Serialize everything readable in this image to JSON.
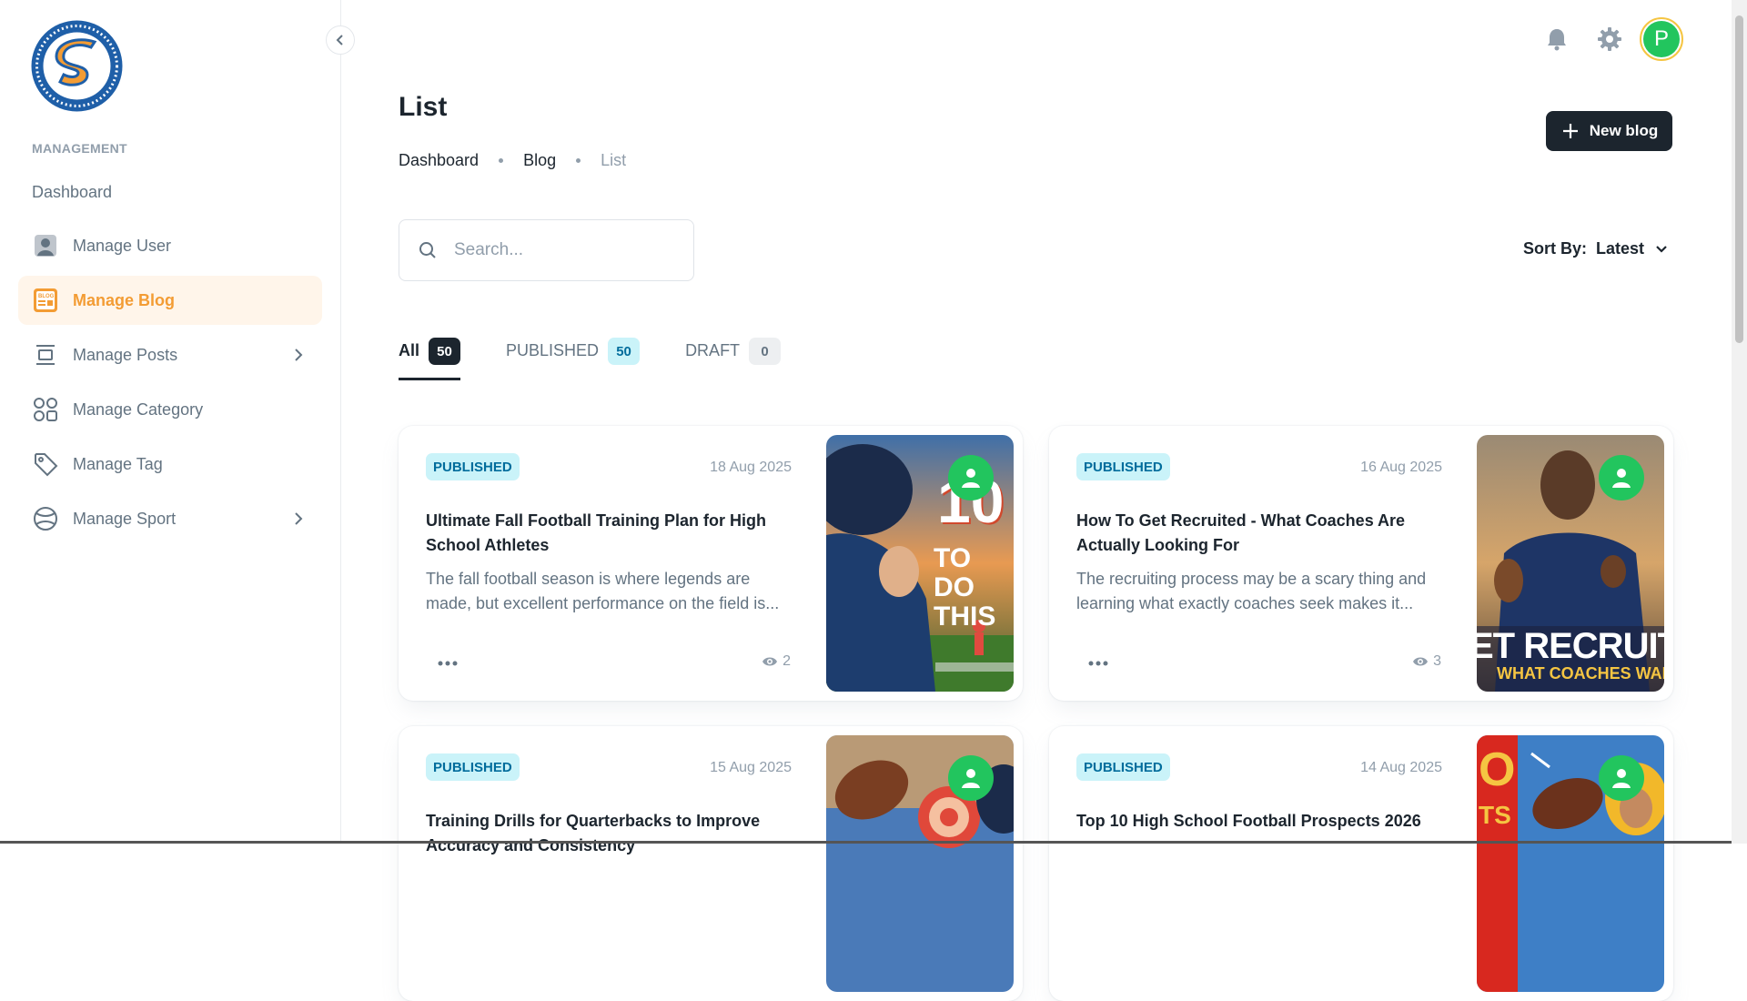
{
  "sidebar": {
    "subheader": "MANAGEMENT",
    "dashboard": "Dashboard",
    "items": [
      {
        "label": "Manage User"
      },
      {
        "label": "Manage Blog"
      },
      {
        "label": "Manage Posts"
      },
      {
        "label": "Manage Category"
      },
      {
        "label": "Manage Tag"
      },
      {
        "label": "Manage Sport"
      }
    ],
    "active_color": "#f39c34"
  },
  "header": {
    "avatar_letter": "P"
  },
  "page": {
    "title": "List",
    "breadcrumb": [
      "Dashboard",
      "Blog",
      "List"
    ],
    "new_button": "New blog",
    "search_placeholder": "Search...",
    "sort_label": "Sort By:",
    "sort_value": "Latest"
  },
  "tabs": [
    {
      "label": "All",
      "count": "50"
    },
    {
      "label": "PUBLISHED",
      "count": "50"
    },
    {
      "label": "DRAFT",
      "count": "0"
    }
  ],
  "posts": [
    {
      "status": "PUBLISHED",
      "date": "18 Aug 2025",
      "title": "Ultimate Fall Football Training Plan for High School Athletes",
      "excerpt": "The fall football season is where legends are made, but excellent performance on the field is...",
      "views": "2",
      "thumb_text_1": "10",
      "thumb_text_2": "TO DO THIS"
    },
    {
      "status": "PUBLISHED",
      "date": "16 Aug 2025",
      "title": "How To Get Recruited - What Coaches Are Actually Looking For",
      "excerpt": "The recruiting process may be a scary thing and learning what exactly coaches seek makes it...",
      "views": "3",
      "thumb_text_1": "ET RECRUITE",
      "thumb_text_2": "WHAT COACHES WANT"
    },
    {
      "status": "PUBLISHED",
      "date": "15 Aug 2025",
      "title": "Training Drills for Quarterbacks to Improve Accuracy and Consistency",
      "excerpt": "",
      "views": ""
    },
    {
      "status": "PUBLISHED",
      "date": "14 Aug 2025",
      "title": "Top 10 High School Football Prospects 2026",
      "excerpt": "",
      "views": "",
      "thumb_text_1": "O",
      "thumb_text_2": "TS"
    }
  ]
}
